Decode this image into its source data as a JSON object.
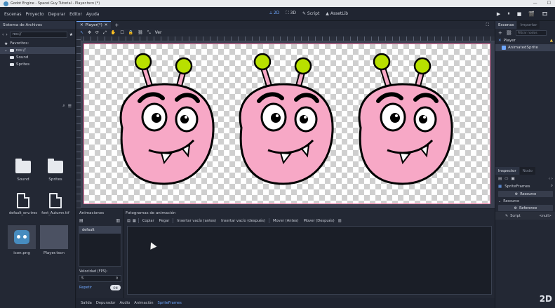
{
  "window": {
    "title": "Godot Engine - Spacei Guy Tutorial - Player.tscn (*)",
    "controls": [
      "—",
      "☐"
    ]
  },
  "menu": [
    "Escenas",
    "Proyecto",
    "Depurar",
    "Editor",
    "Ayuda"
  ],
  "workspaces": [
    {
      "label": "2D",
      "icon": "2d-icon"
    },
    {
      "label": "3D",
      "icon": "3d-icon"
    },
    {
      "label": "Script",
      "icon": "script-icon"
    },
    {
      "label": "AssetLib",
      "icon": "assetlib-icon"
    }
  ],
  "playbar": [
    "▶",
    "⏸",
    "■",
    "🎬",
    "🎞"
  ],
  "filesystem": {
    "title": "Sistema de Archivos",
    "path": "res://",
    "tree": [
      {
        "label": "Favoritos:",
        "icon": "star-icon"
      },
      {
        "label": "res://",
        "icon": "folder-icon",
        "selected": true
      },
      {
        "label": "Sound",
        "icon": "folder-icon"
      },
      {
        "label": "Sprites",
        "icon": "folder-icon"
      }
    ],
    "files": [
      {
        "label": "Sound",
        "kind": "folder"
      },
      {
        "label": "Sprites",
        "kind": "folder"
      },
      {
        "label": "default_env.tres",
        "kind": "resource"
      },
      {
        "label": "font_Autumn.ttf",
        "kind": "resource"
      },
      {
        "label": "icon.png",
        "kind": "image"
      },
      {
        "label": "Player.tscn",
        "kind": "scene",
        "selected": true
      }
    ]
  },
  "editor": {
    "tab_label": "Player(*)",
    "toolbar": [
      "↖",
      "✥",
      "⟳",
      "⤢",
      "✋",
      "☐",
      "🔒",
      "⛓",
      "⤡",
      "Ver"
    ]
  },
  "scene_dock": {
    "tabs": [
      "Escenas",
      "Importar"
    ],
    "filter_placeholder": "Filtrar nodos",
    "nodes": [
      {
        "label": "Player",
        "icon": "kinematic-body-icon"
      },
      {
        "label": "AnimatedSprite",
        "icon": "animated-sprite-icon",
        "selected": true
      }
    ]
  },
  "inspector": {
    "tabs": [
      "Inspector",
      "Nodo"
    ],
    "object": "SpriteFrames",
    "resource_button": "Resource",
    "section": "Resource",
    "reference_button": "Reference",
    "prop_name": "Script",
    "prop_value": "<null>"
  },
  "sprite_frames": {
    "animations_title": "Animaciones",
    "frames_title": "Fotogramas de animación",
    "animation": "default",
    "fps_label": "Velocidad (FPS):",
    "fps_value": "5",
    "loop_label": "Repetir",
    "loop_state": "ON",
    "frame_tools": [
      "Copiar",
      "Pegar",
      "Insertar vacío (antes)",
      "Insertar vacío (después)",
      "Mover (Antes)",
      "Mover (Después)"
    ]
  },
  "bottom_tabs": [
    "Salida",
    "Depurador",
    "Audio",
    "Animación",
    "SpriteFrames"
  ],
  "watermark": "2D",
  "colors": {
    "accent": "#6fa8ff",
    "monster_pink": "#f7a8c6",
    "antenna_green": "#b8e000"
  }
}
